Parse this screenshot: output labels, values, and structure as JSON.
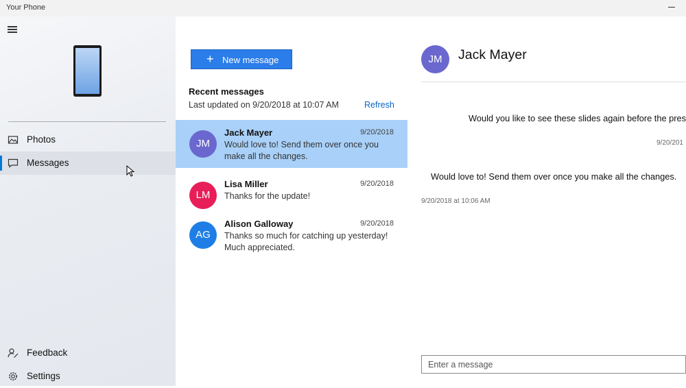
{
  "window": {
    "title": "Your Phone"
  },
  "sidebar": {
    "items": [
      {
        "label": "Photos",
        "icon": "photos-icon",
        "active": false
      },
      {
        "label": "Messages",
        "icon": "messages-icon",
        "active": true
      }
    ],
    "bottom_items": [
      {
        "label": "Feedback",
        "icon": "feedback-icon"
      },
      {
        "label": "Settings",
        "icon": "gear-icon"
      }
    ]
  },
  "messages_list": {
    "new_message_label": "New message",
    "recent_title": "Recent messages",
    "last_updated": "Last updated on 9/20/2018 at 10:07 AM",
    "refresh_label": "Refresh",
    "conversations": [
      {
        "initials": "JM",
        "name": "Jack Mayer",
        "date": "9/20/2018",
        "preview": "Would love to! Send them over once you make all the changes.",
        "avatar_color": "#6a67ce",
        "selected": true
      },
      {
        "initials": "LM",
        "name": "Lisa Miller",
        "date": "9/20/2018",
        "preview": "Thanks for the update!",
        "avatar_color": "#e81e58",
        "selected": false
      },
      {
        "initials": "AG",
        "name": "Alison Galloway",
        "date": "9/20/2018",
        "preview": "Thanks so much for catching up yesterday! Much appreciated.",
        "avatar_color": "#1e7ee6",
        "selected": false
      }
    ]
  },
  "chat": {
    "contact_initials": "JM",
    "contact_name": "Jack Mayer",
    "messages": [
      {
        "text": "Would you like to see these slides again before the prese",
        "time": "9/20/201",
        "direction": "outgoing"
      },
      {
        "text": "Would love to! Send them over once you make all the changes.",
        "time": "9/20/2018 at 10:06 AM",
        "direction": "incoming"
      }
    ],
    "compose_placeholder": "Enter a message"
  },
  "colors": {
    "accent": "#0078d7",
    "button_blue": "#2b7de9",
    "selected_row": "#a9d0f8",
    "refresh_link": "#0a64c8"
  }
}
